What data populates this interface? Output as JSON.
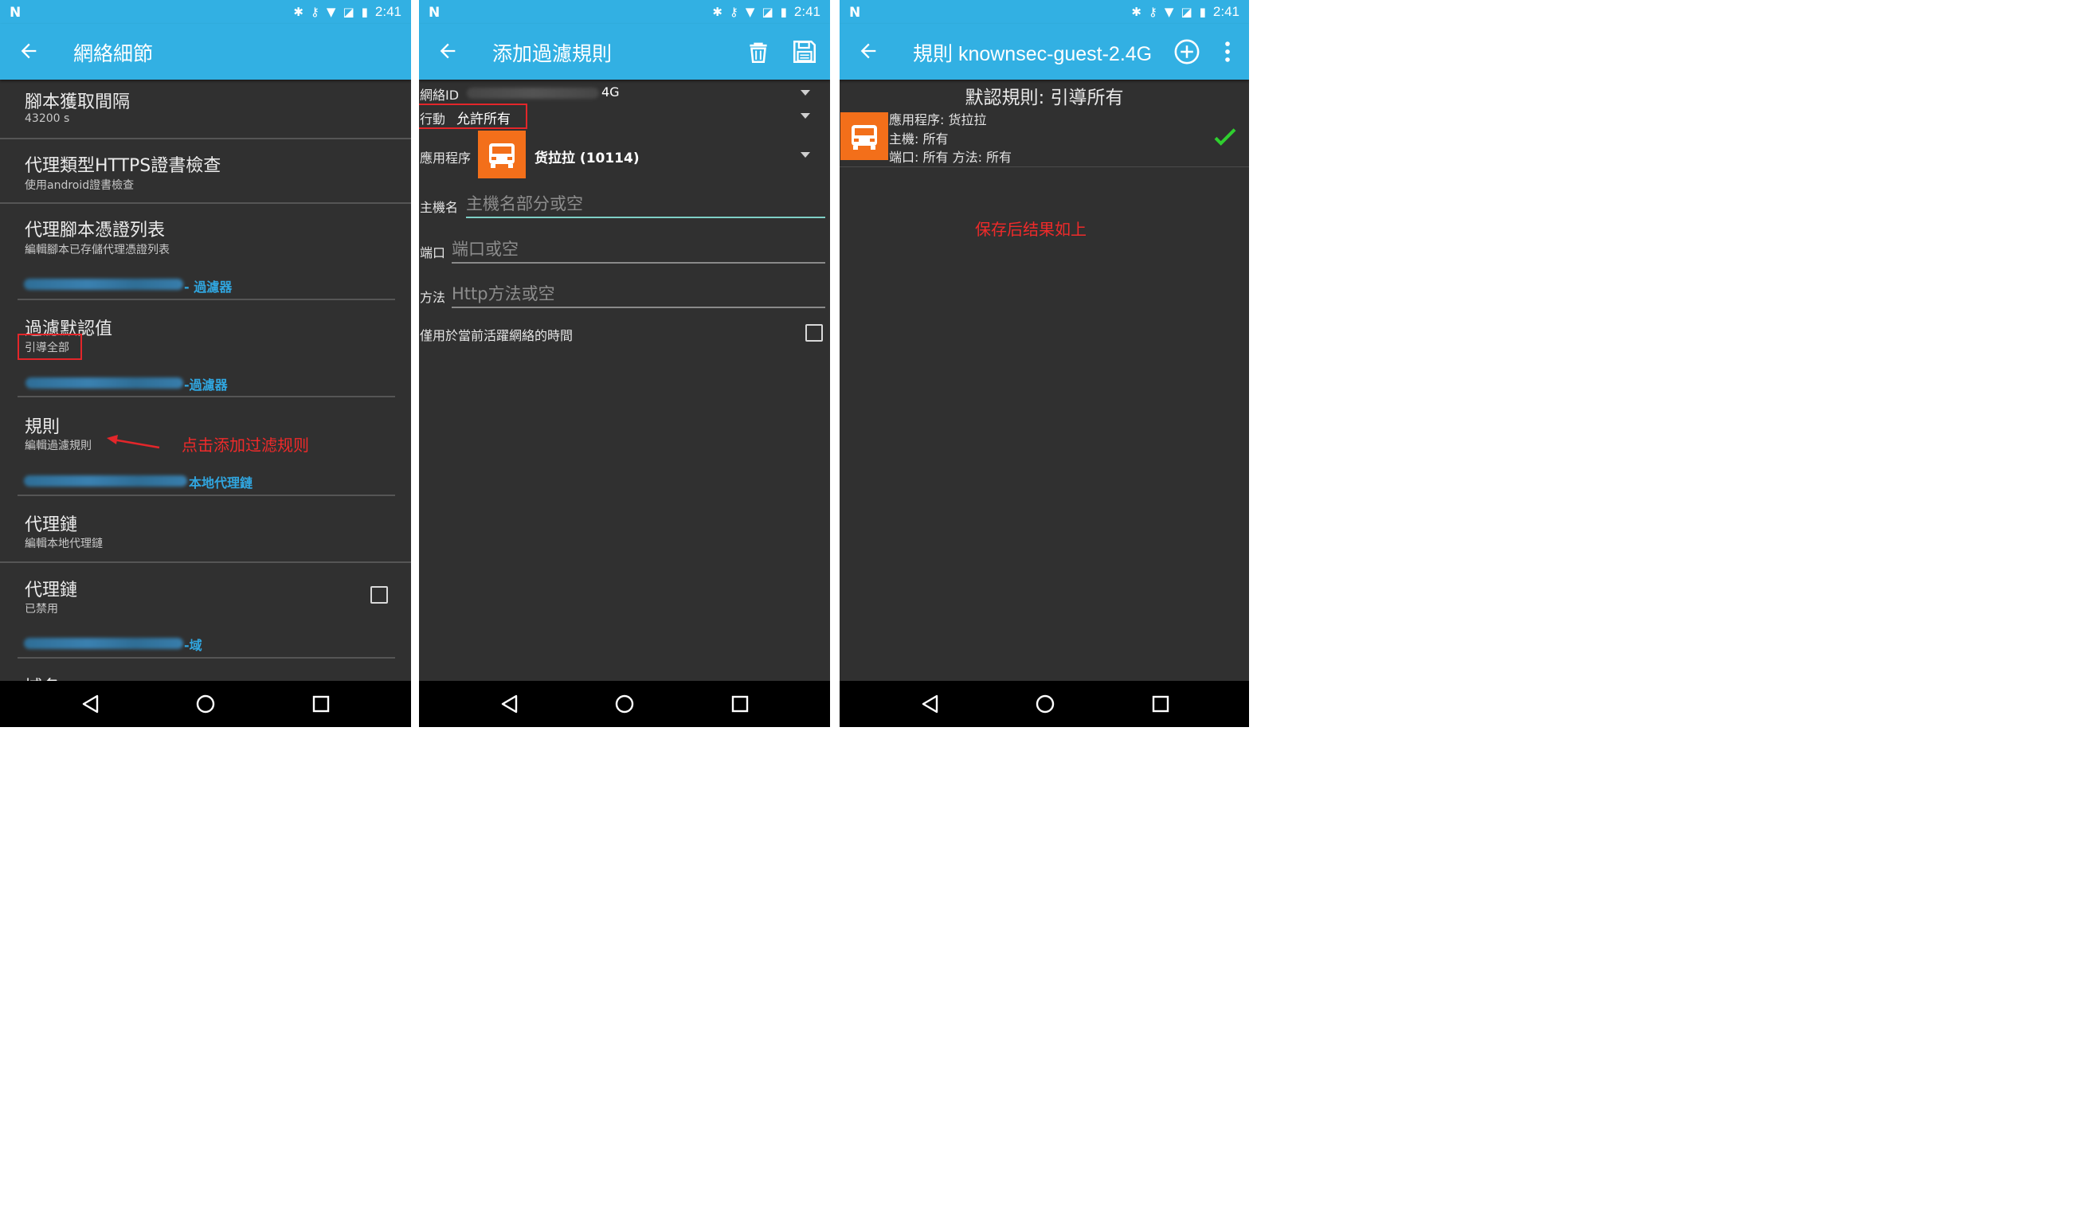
{
  "status": {
    "time": "2:41"
  },
  "panel1": {
    "title": "網絡細節",
    "items": [
      {
        "title": "腳本獲取間隔",
        "subtitle": "43200 s"
      },
      {
        "title": "代理類型HTTPS證書檢查",
        "subtitle": "使用android證書檢查"
      },
      {
        "title": "代理腳本憑證列表",
        "subtitle": "編輯腳本已存儲代理憑證列表"
      },
      {
        "title": "過濾默認值",
        "subtitle": "引導全部"
      },
      {
        "title": "規則",
        "subtitle": "編輯過濾規則"
      },
      {
        "title": "代理鏈",
        "subtitle": "編輯本地代理鏈"
      },
      {
        "title": "代理鏈",
        "subtitle": "已禁用"
      },
      {
        "title": "域名",
        "subtitle": ""
      }
    ],
    "categories": [
      "- 過濾器",
      "-過濾器",
      "本地代理鏈",
      "-域"
    ],
    "annotation": "点击添加过滤规则"
  },
  "panel2": {
    "title": "添加過濾規則",
    "network_label": "網絡ID",
    "network_suffix": "4G",
    "action_label": "行動",
    "action_value": "允許所有",
    "app_label": "應用程序",
    "app_value": "货拉拉 (10114)",
    "host_label": "主機名",
    "host_placeholder": "主機名部分或空",
    "port_label": "端口",
    "port_placeholder": "端口或空",
    "method_label": "方法",
    "method_placeholder": "Http方法或空",
    "active_only_label": "僅用於當前活躍網絡的時間"
  },
  "panel3": {
    "title": "規則 knownsec-guest-2.4G",
    "default_rule": "默認規則:  引導所有",
    "rule": {
      "app_line": "應用程序: 货拉拉",
      "host_line": "主機: 所有",
      "port_method_line": "端口: 所有 方法: 所有"
    },
    "annotation": "保存后结果如上"
  },
  "colors": {
    "accent": "#32b0e3",
    "background": "#303030",
    "annotation": "#ef2a2a",
    "check": "#2fcf2f",
    "app_icon": "#f36f1a"
  }
}
